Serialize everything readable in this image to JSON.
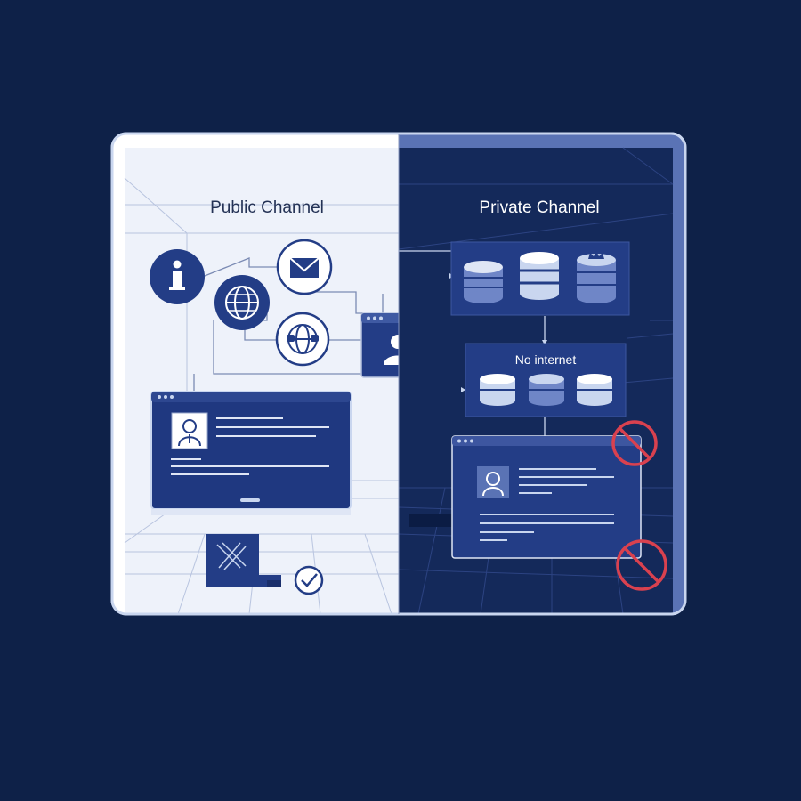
{
  "colors": {
    "background": "#0e2148",
    "frame_border": "#c9d6ef",
    "public_bg": "#eef2fa",
    "private_bg": "#14295a",
    "navy": "#233d86",
    "navy_dark": "#1a2f6b",
    "line_light": "#8796bd",
    "line_dark": "#5a73b5",
    "prohibit_red": "#d9414f"
  },
  "public_panel": {
    "title": "Public Channel",
    "icons": [
      "info-icon",
      "globe-icon",
      "mail-icon",
      "globe-network-icon",
      "user-profile-window-icon",
      "checkmark-icon",
      "laptop-icon"
    ]
  },
  "private_panel": {
    "title": "Private Channel",
    "isolated_label": "No internet",
    "icons": [
      "database-icon",
      "database-crown-icon",
      "prohibited-icon"
    ]
  }
}
